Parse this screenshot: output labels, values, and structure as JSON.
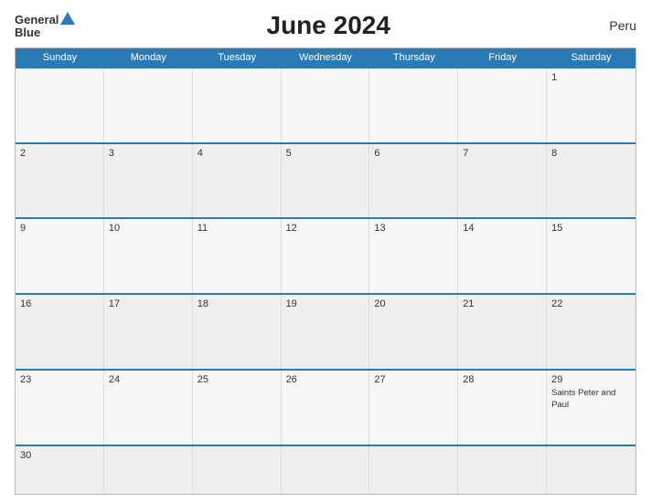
{
  "header": {
    "logo_line1": "General",
    "logo_line2": "Blue",
    "title": "June 2024",
    "country": "Peru"
  },
  "days_of_week": [
    "Sunday",
    "Monday",
    "Tuesday",
    "Wednesday",
    "Thursday",
    "Friday",
    "Saturday"
  ],
  "weeks": [
    [
      {
        "num": "",
        "holiday": ""
      },
      {
        "num": "",
        "holiday": ""
      },
      {
        "num": "",
        "holiday": ""
      },
      {
        "num": "",
        "holiday": ""
      },
      {
        "num": "",
        "holiday": ""
      },
      {
        "num": "",
        "holiday": ""
      },
      {
        "num": "1",
        "holiday": ""
      }
    ],
    [
      {
        "num": "2",
        "holiday": ""
      },
      {
        "num": "3",
        "holiday": ""
      },
      {
        "num": "4",
        "holiday": ""
      },
      {
        "num": "5",
        "holiday": ""
      },
      {
        "num": "6",
        "holiday": ""
      },
      {
        "num": "7",
        "holiday": ""
      },
      {
        "num": "8",
        "holiday": ""
      }
    ],
    [
      {
        "num": "9",
        "holiday": ""
      },
      {
        "num": "10",
        "holiday": ""
      },
      {
        "num": "11",
        "holiday": ""
      },
      {
        "num": "12",
        "holiday": ""
      },
      {
        "num": "13",
        "holiday": ""
      },
      {
        "num": "14",
        "holiday": ""
      },
      {
        "num": "15",
        "holiday": ""
      }
    ],
    [
      {
        "num": "16",
        "holiday": ""
      },
      {
        "num": "17",
        "holiday": ""
      },
      {
        "num": "18",
        "holiday": ""
      },
      {
        "num": "19",
        "holiday": ""
      },
      {
        "num": "20",
        "holiday": ""
      },
      {
        "num": "21",
        "holiday": ""
      },
      {
        "num": "22",
        "holiday": ""
      }
    ],
    [
      {
        "num": "23",
        "holiday": ""
      },
      {
        "num": "24",
        "holiday": ""
      },
      {
        "num": "25",
        "holiday": ""
      },
      {
        "num": "26",
        "holiday": ""
      },
      {
        "num": "27",
        "holiday": ""
      },
      {
        "num": "28",
        "holiday": ""
      },
      {
        "num": "29",
        "holiday": "Saints Peter and Paul"
      }
    ],
    [
      {
        "num": "30",
        "holiday": ""
      },
      {
        "num": "",
        "holiday": ""
      },
      {
        "num": "",
        "holiday": ""
      },
      {
        "num": "",
        "holiday": ""
      },
      {
        "num": "",
        "holiday": ""
      },
      {
        "num": "",
        "holiday": ""
      },
      {
        "num": "",
        "holiday": ""
      }
    ]
  ]
}
